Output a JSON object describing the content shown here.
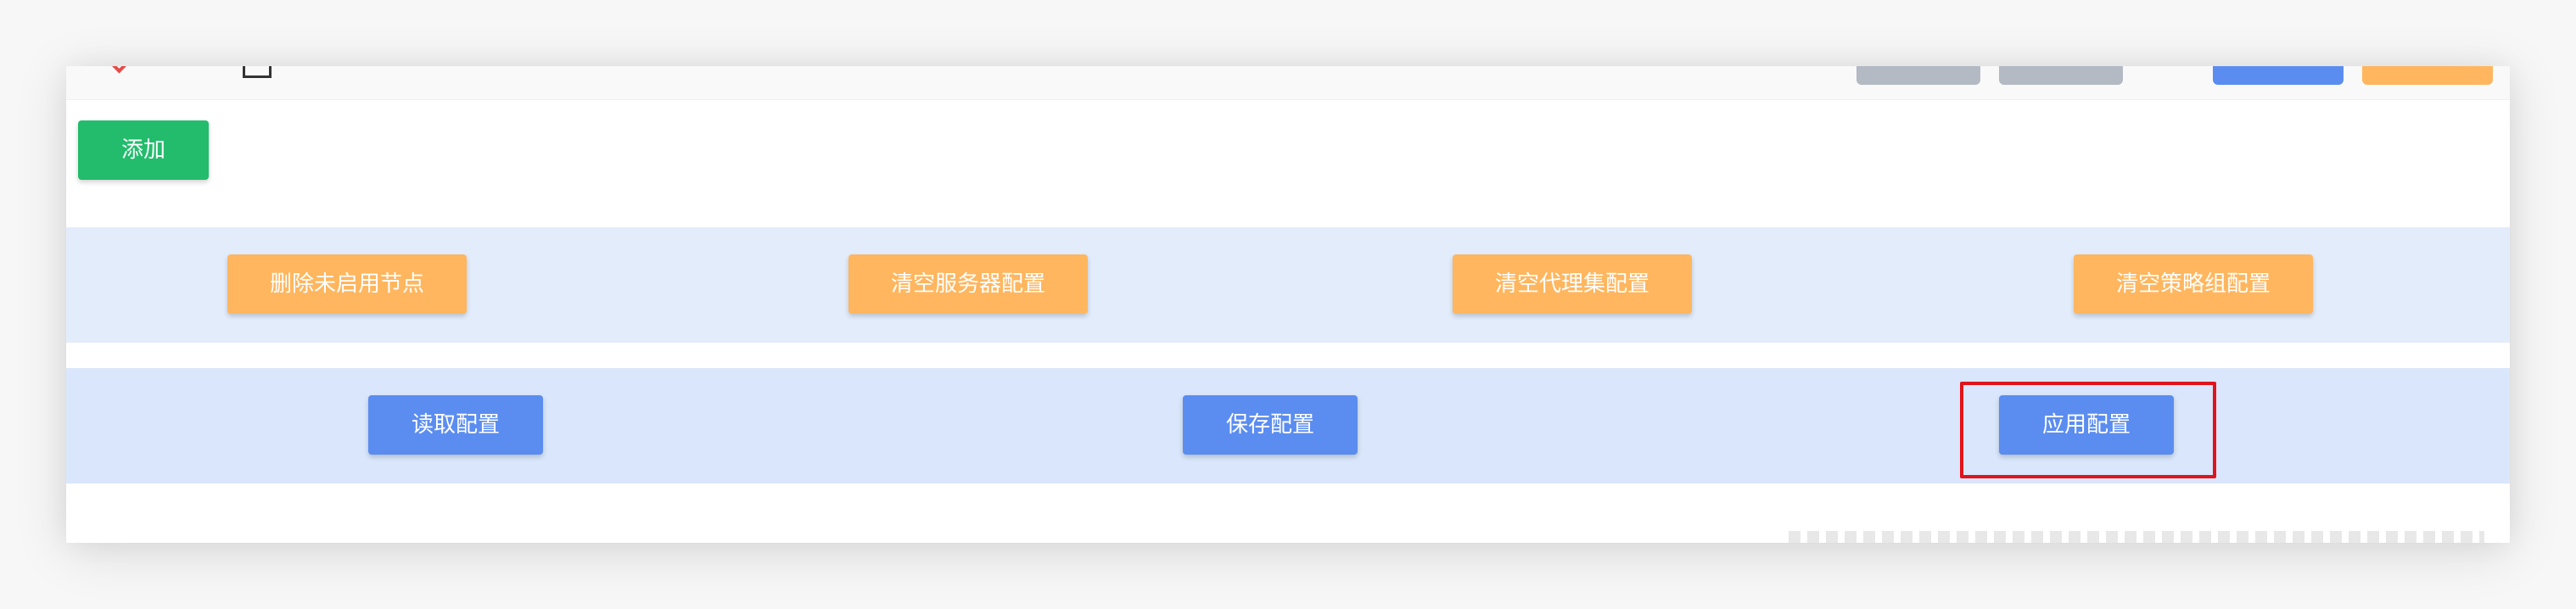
{
  "toolbar": {
    "add_label": "添加"
  },
  "cleanup_row": {
    "buttons": [
      {
        "label": "删除未启用节点"
      },
      {
        "label": "清空服务器配置"
      },
      {
        "label": "清空代理集配置"
      },
      {
        "label": "清空策略组配置"
      }
    ]
  },
  "config_row": {
    "buttons": [
      {
        "label": "读取配置"
      },
      {
        "label": "保存配置"
      },
      {
        "label": "应用配置"
      }
    ],
    "highlighted": "应用配置"
  },
  "colors": {
    "green": "#22bc6c",
    "orange": "#ffb65e",
    "blue": "#5b8df0",
    "band_light": "#e2ecfb",
    "highlight_red": "#e0141b"
  }
}
